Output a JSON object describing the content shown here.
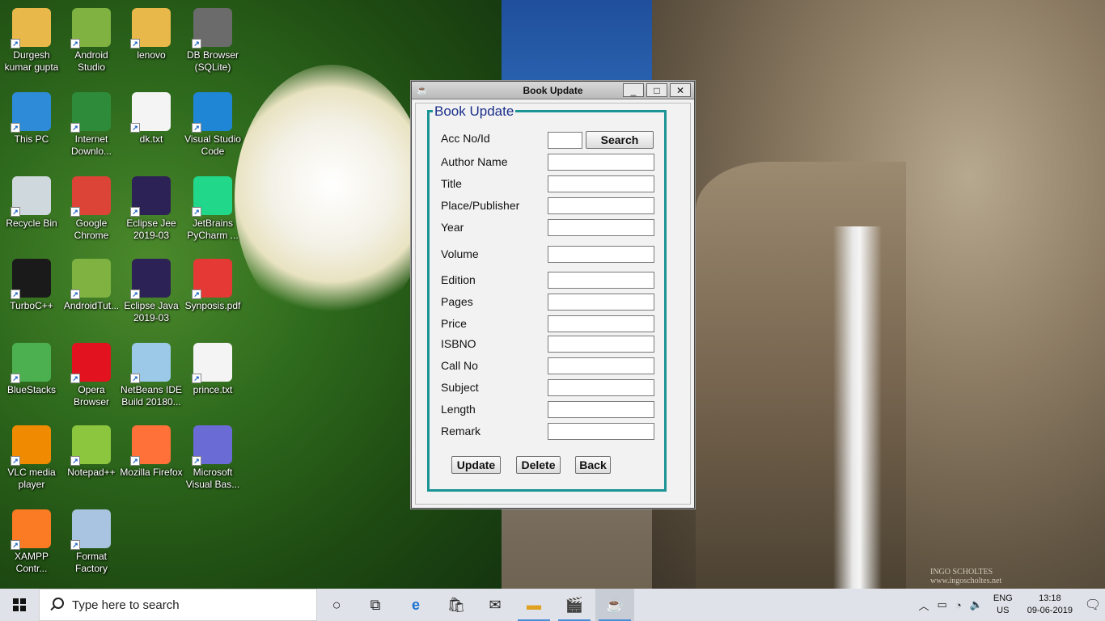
{
  "desktop": {
    "icons": [
      {
        "label": "Durgesh kumar gupta",
        "icon": "user-folder-icon",
        "color": "#e8b84a"
      },
      {
        "label": "Android Studio",
        "icon": "android-studio-icon",
        "color": "#7fb241"
      },
      {
        "label": "lenovo",
        "icon": "pdf-folder-icon",
        "color": "#e8b84a"
      },
      {
        "label": "DB Browser (SQLite)",
        "icon": "database-icon",
        "color": "#6b6b6b"
      },
      {
        "label": "This PC",
        "icon": "computer-icon",
        "color": "#2d8bd8"
      },
      {
        "label": "Internet Downlo...",
        "icon": "internet-download-manager-icon",
        "color": "#2d8b3a"
      },
      {
        "label": "dk.txt",
        "icon": "text-file-icon",
        "color": "#f4f4f4"
      },
      {
        "label": "Visual Studio Code",
        "icon": "vscode-icon",
        "color": "#1f86d6"
      },
      {
        "label": "Recycle Bin",
        "icon": "recycle-bin-icon",
        "color": "#cfd8dc"
      },
      {
        "label": "Google Chrome",
        "icon": "chrome-icon",
        "color": "#db4437"
      },
      {
        "label": "Eclipse Jee 2019-03",
        "icon": "eclipse-icon",
        "color": "#2c2255"
      },
      {
        "label": "JetBrains PyCharm ...",
        "icon": "pycharm-icon",
        "color": "#21d789"
      },
      {
        "label": "TurboC++",
        "icon": "turbo-cpp-icon",
        "color": "#1a1a1a"
      },
      {
        "label": "AndroidTut...",
        "icon": "android-studio-icon",
        "color": "#7fb241"
      },
      {
        "label": "Eclipse Java 2019-03",
        "icon": "eclipse-icon",
        "color": "#2c2255"
      },
      {
        "label": "Synposis.pdf",
        "icon": "pdf-icon",
        "color": "#e53935"
      },
      {
        "label": "BlueStacks",
        "icon": "bluestacks-icon",
        "color": "#4caf50"
      },
      {
        "label": "Opera Browser",
        "icon": "opera-icon",
        "color": "#e3121f"
      },
      {
        "label": "NetBeans IDE Build 20180...",
        "icon": "netbeans-icon",
        "color": "#9cc9e8"
      },
      {
        "label": "prince.txt",
        "icon": "text-file-icon",
        "color": "#f4f4f4"
      },
      {
        "label": "VLC media player",
        "icon": "vlc-icon",
        "color": "#f08a00"
      },
      {
        "label": "Notepad++",
        "icon": "notepad-plus-plus-icon",
        "color": "#8cc63f"
      },
      {
        "label": "Mozilla Firefox",
        "icon": "firefox-icon",
        "color": "#ff7139"
      },
      {
        "label": "Microsoft Visual Bas...",
        "icon": "visual-basic-icon",
        "color": "#6b6bd6"
      },
      {
        "label": "XAMPP Contr...",
        "icon": "xampp-icon",
        "color": "#fb7a24"
      },
      {
        "label": "Format Factory",
        "icon": "format-factory-icon",
        "color": "#a8c4e0"
      }
    ],
    "watermark": "INGO SCHOLTES\nwww.ingoscholtes.net"
  },
  "window": {
    "title": "Book Update",
    "controls": {
      "minimize": "_",
      "maximize": "□",
      "close": "✕"
    },
    "group_title": "Book Update",
    "acc_label": "Acc No/Id",
    "acc_value": "",
    "search_label": "Search",
    "fields": [
      {
        "label": "Author Name",
        "value": ""
      },
      {
        "label": "Title",
        "value": ""
      },
      {
        "label": "Place/Publisher",
        "value": ""
      },
      {
        "label": "Year",
        "value": ""
      },
      {
        "label": "Volume",
        "value": ""
      },
      {
        "label": "Edition",
        "value": ""
      },
      {
        "label": "Pages",
        "value": ""
      },
      {
        "label": "Price",
        "value": ""
      },
      {
        "label": "ISBNO",
        "value": ""
      },
      {
        "label": "Call No",
        "value": ""
      },
      {
        "label": "Subject",
        "value": ""
      },
      {
        "label": "Length",
        "value": ""
      },
      {
        "label": "Remark",
        "value": ""
      }
    ],
    "buttons": {
      "update": "Update",
      "delete": "Delete",
      "back": "Back"
    }
  },
  "taskbar": {
    "search_placeholder": "Type here to search",
    "language": "ENG",
    "region": "US",
    "time": "13:18",
    "date": "09-06-2019"
  }
}
